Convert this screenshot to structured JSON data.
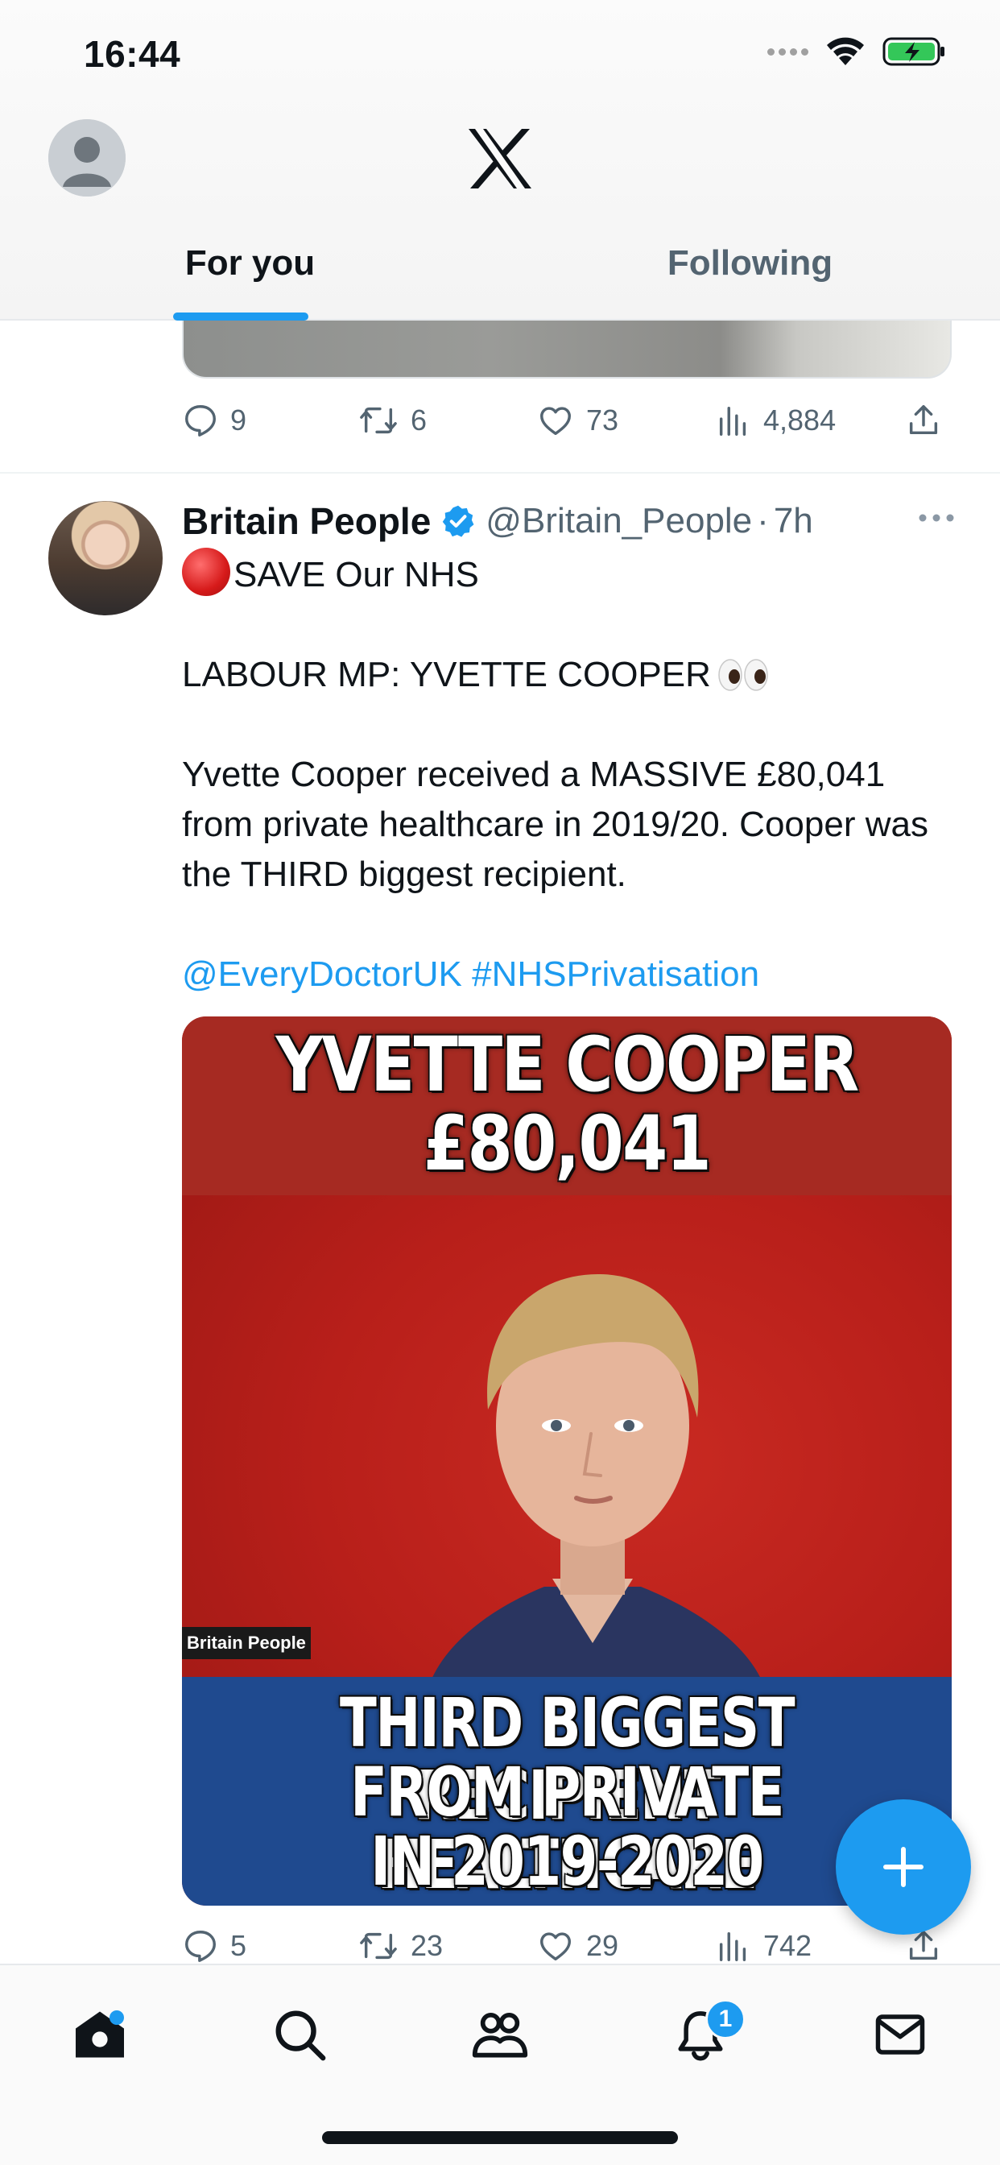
{
  "status_bar": {
    "time": "16:44"
  },
  "header": {
    "tabs": [
      {
        "label": "For you",
        "active": true
      },
      {
        "label": "Following",
        "active": false
      }
    ]
  },
  "previous_tweet": {
    "actions": {
      "replies": "9",
      "reposts": "6",
      "likes": "73",
      "views": "4,884"
    }
  },
  "tweet": {
    "author_name": "Britain People",
    "handle": "@Britain_People",
    "separator": "·",
    "time": "7h",
    "text_line1": "SAVE Our NHS",
    "text_line2": "LABOUR MP:  YVETTE COOPER",
    "text_line3": "Yvette Cooper received a MASSIVE £80,041 from private healthcare in 2019/20.  Cooper was the THIRD biggest recipient.",
    "mention": "@EveryDoctorUK",
    "hashtag": "#NHSPrivatisation",
    "image": {
      "headline_line1": "YVETTE COOPER",
      "headline_line2": "£80,041",
      "watermark": "Britain People",
      "bottom_line1": "THIRD BIGGEST RECIPIENT",
      "bottom_line2": "FROM PRIVATE HEALTHCARE",
      "bottom_line3": "IN 2019-2020"
    },
    "actions": {
      "replies": "5",
      "reposts": "23",
      "likes": "29",
      "views": "742"
    }
  },
  "bottom_nav": {
    "notifications_badge": "1",
    "items": [
      "home-icon",
      "search-icon",
      "communities-icon",
      "bell-icon",
      "mail-icon"
    ]
  },
  "colors": {
    "accent": "#1d9bf0",
    "text": "#0f1419",
    "secondary": "#536471"
  }
}
